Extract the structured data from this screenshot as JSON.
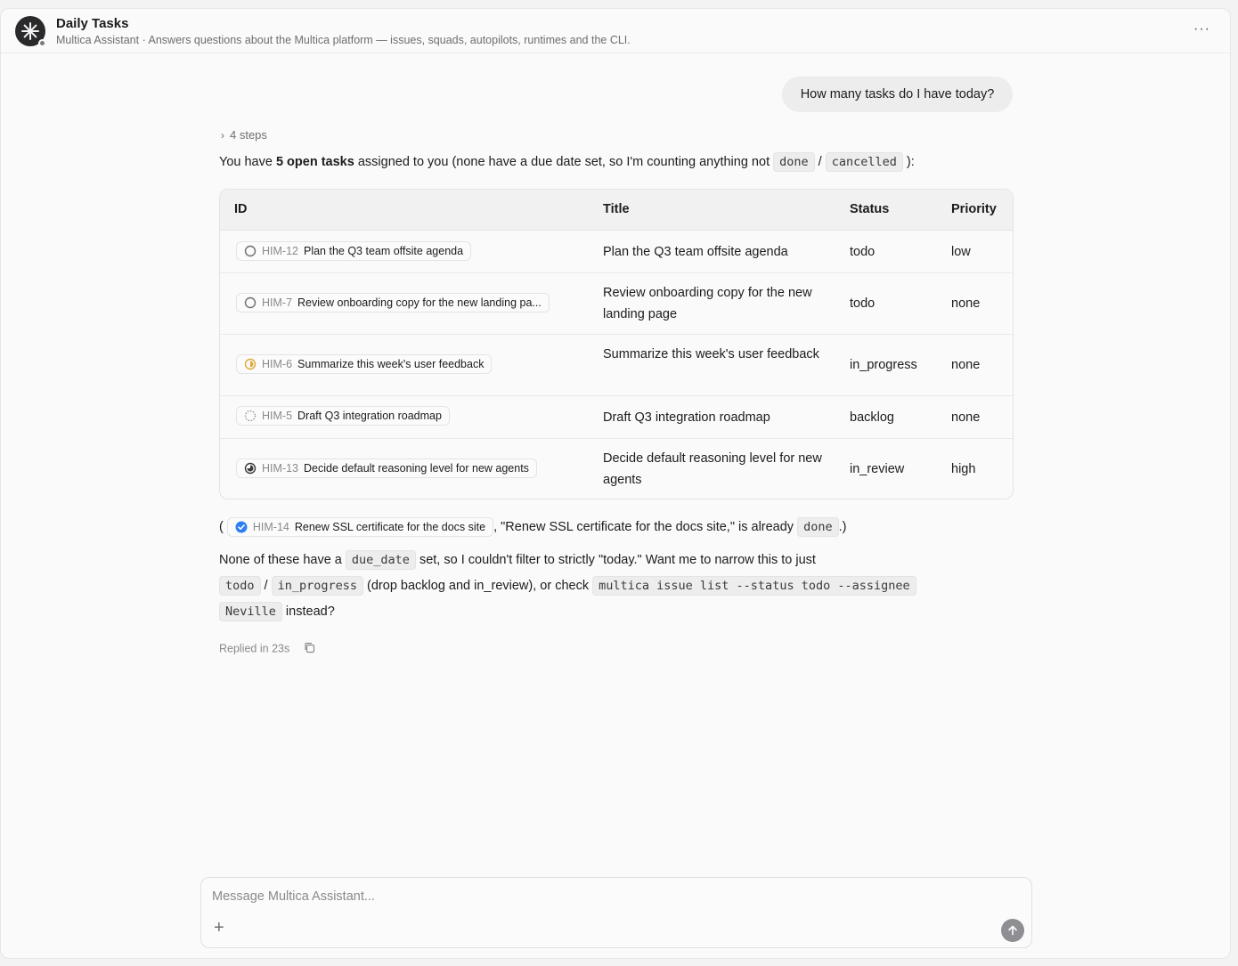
{
  "header": {
    "title": "Daily Tasks",
    "subtitle": "Multica Assistant · Answers questions about the Multica platform — issues, squads, autopilots, runtimes and the CLI.",
    "more": "···"
  },
  "user_message": "How many tasks do I have today?",
  "steps_label": "4 steps",
  "intro": {
    "pre": "You have ",
    "bold": "5 open tasks",
    "mid": " assigned to you (none have a due date set, so I'm counting anything not ",
    "code1": "done",
    "sep": " / ",
    "code2": "cancelled",
    "post": " ):"
  },
  "table": {
    "headers": {
      "id": "ID",
      "title": "Title",
      "status": "Status",
      "priority": "Priority"
    },
    "rows": [
      {
        "id": "HIM-12",
        "chip_title": "Plan the Q3 team offsite agenda",
        "icon": "status-todo-icon",
        "title": "Plan the Q3 team offsite agenda",
        "status": "todo",
        "priority": "low"
      },
      {
        "id": "HIM-7",
        "chip_title": "Review onboarding copy for the new landing pa...",
        "icon": "status-todo-icon",
        "title": "Review onboarding copy for the new landing page",
        "status": "todo",
        "priority": "none"
      },
      {
        "id": "HIM-6",
        "chip_title": "Summarize this week's user feedback",
        "icon": "status-in-progress-icon",
        "title": "Summarize this week's user feedback",
        "status": "in_progress",
        "priority": "none"
      },
      {
        "id": "HIM-5",
        "chip_title": "Draft Q3 integration roadmap",
        "icon": "status-backlog-icon",
        "title": "Draft Q3 integration roadmap",
        "status": "backlog",
        "priority": "none"
      },
      {
        "id": "HIM-13",
        "chip_title": "Decide default reasoning level for new agents",
        "icon": "status-in-review-icon",
        "title": "Decide default reasoning level for new agents",
        "status": "in_review",
        "priority": "high"
      }
    ]
  },
  "done_note": {
    "open": "(",
    "chip_id": "HIM-14",
    "chip_title": "Renew SSL certificate for the docs site",
    "mid": ", \"Renew SSL certificate for the docs site,\" is already ",
    "code": "done",
    "close": ".)"
  },
  "followup": {
    "line1_pre": "None of these have a ",
    "line1_code": "due_date",
    "line1_post": " set, so I couldn't filter to strictly \"today.\" Want me to narrow this to just",
    "line2_code1": "todo",
    "line2_sep": " / ",
    "line2_code2": "in_progress",
    "line2_mid": " (drop backlog and in_review), or check ",
    "line2_code3": "multica issue list --status todo --assignee",
    "line3_code": "Neville",
    "line3_post": " instead?"
  },
  "meta": "Replied in 23s",
  "composer": {
    "placeholder": "Message Multica Assistant..."
  },
  "colors": {
    "in_progress": "#e0a93a",
    "done": "#2f7ff2",
    "avatar": "#2a2a2c"
  }
}
